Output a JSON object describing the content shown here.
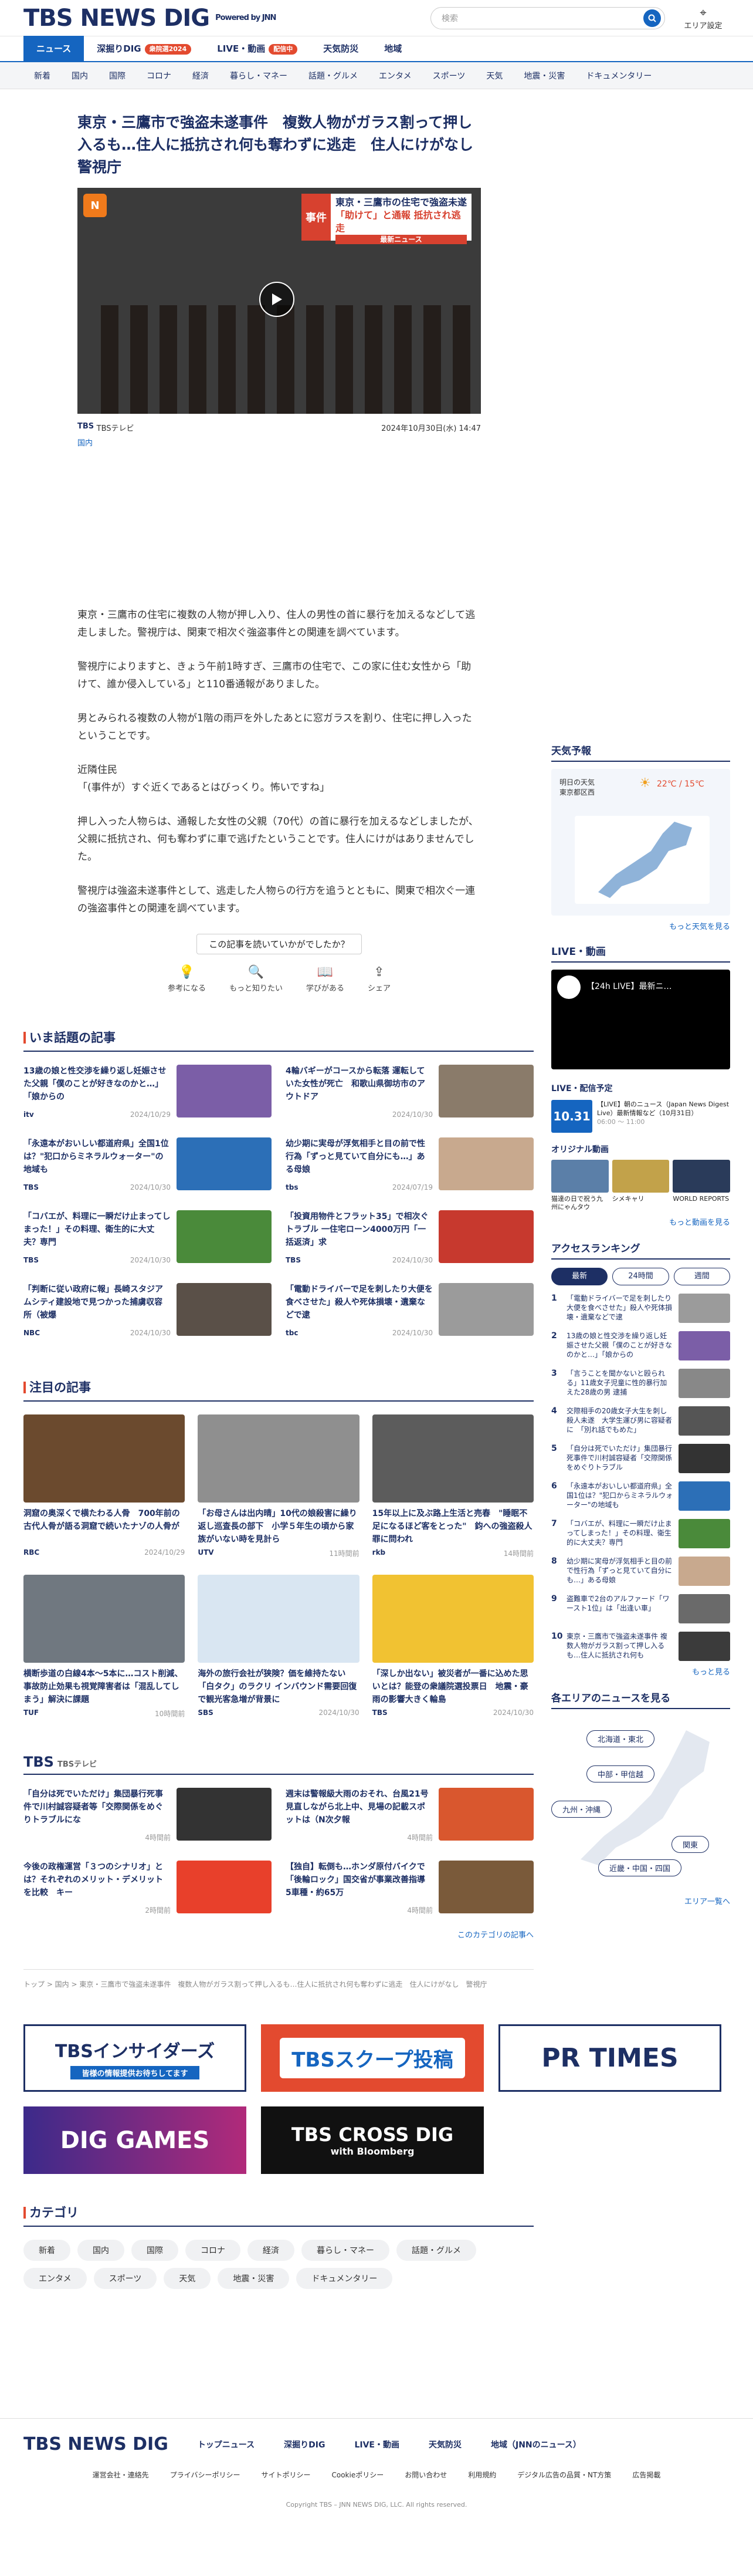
{
  "header": {
    "logo": "TBS NEWS DIG",
    "powered": "Powered by JNN",
    "search_placeholder": "検索",
    "area_label": "エリア設定"
  },
  "nav1": [
    {
      "label": "ニュース"
    },
    {
      "label": "深掘りDIG",
      "tag": "衆院選2024"
    },
    {
      "label": "LIVE・動画",
      "tag": "配信中"
    },
    {
      "label": "天気防災"
    },
    {
      "label": "地域"
    }
  ],
  "nav2": [
    "新着",
    "国内",
    "国際",
    "コロナ",
    "経済",
    "暮らし・マネー",
    "話題・グルメ",
    "エンタメ",
    "スポーツ",
    "天気",
    "地震・災害",
    "ドキュメンタリー"
  ],
  "article": {
    "title": "東京・三鷹市で強盗未遂事件　複数人物がガラス割って押し入るも…住人に抵抗され何も奪わずに逃走　住人にけがなし　警視庁",
    "video_badge": [
      "東京・三鷹市の住宅で強盗未遂",
      "「助けて」と通報 抵抗され逃走",
      "最新ニュース"
    ],
    "video_tag": "事件",
    "source": "TBSテレビ",
    "date": "2024年10月30日(水) 14:47",
    "category": "国内",
    "paragraphs": [
      "東京・三鷹市の住宅に複数の人物が押し入り、住人の男性の首に暴行を加えるなどして逃走しました。警視庁は、関東で相次ぐ強盗事件との関連を調べています。",
      "警視庁によりますと、きょう午前1時すぎ、三鷹市の住宅で、この家に住む女性から「助けて、誰か侵入している」と110番通報がありました。",
      "男とみられる複数の人物が1階の雨戸を外したあとに窓ガラスを割り、住宅に押し入ったということです。",
      "近隣住民\n「(事件が）すぐ近くであるとはびっくり。怖いですね」",
      "押し入った人物らは、通報した女性の父親（70代）の首に暴行を加えるなどしましたが、父親に抵抗され、何も奪わずに車で逃げたということです。住人にけがはありませんでした。",
      "警視庁は強盗未遂事件として、逃走した人物らの行方を追うとともに、関東で相次ぐ一連の強盗事件との関連を調べています。"
    ],
    "feedback_q": "この記事を読いていかがでしたか？",
    "feedback": [
      "参考になる",
      "もっと知りたい",
      "学びがある",
      "シェア"
    ]
  },
  "hot": {
    "title": "いま話題の記事",
    "items": [
      {
        "title": "13歳の娘と性交渉を繰り返し妊娠させた父親「僕のことが好きなのかと…」「娘からの",
        "src": "itv",
        "date": "2024/10/29",
        "color": "#7b5ea7"
      },
      {
        "title": "4輪バギーがコースから転落 運転していた女性が死亡　和歌山県御坊市のアウトドア",
        "src": "",
        "date": "2024/10/30",
        "color": "#8a7b6a"
      },
      {
        "title": "「永遠本がおいしい都道府県」全国1位は？\"犯口からミネラルウォーター\"の地域も",
        "src": "TBS",
        "date": "2024/10/30",
        "color": "#2c6fb7"
      },
      {
        "title": "幼少期に実母が浮気相手と目の前で性行為「ずっと見ていて自分にも…」ある母娘",
        "src": "tbs",
        "date": "2024/07/19",
        "color": "#c8a98e"
      },
      {
        "title": "「コバエが、料理に一瞬だけ止まってしまった！」その料理、衛生的に大丈夫？専門",
        "src": "TBS",
        "date": "2024/10/30",
        "color": "#4a8a3a"
      },
      {
        "title": "「投資用物件とフラット35」で相次ぐトラブル 一住宅ローン4000万円「一括返済」求",
        "src": "TBS",
        "date": "2024/10/30",
        "color": "#c7392e"
      },
      {
        "title": "「判断に従い政府に報」長崎スタジアムシティ建設地で見つかった捕虜収容所（被爆",
        "src": "NBC",
        "date": "2024/10/30",
        "color": "#5a5048"
      },
      {
        "title": "「電動ドライバーで足を刺したり大便を食べさせた」殺人や死体損壊・遺棄などで逮",
        "src": "tbc",
        "date": "2024/10/30",
        "color": "#9b9b9b"
      }
    ]
  },
  "attention": {
    "title": "注目の記事",
    "items": [
      {
        "title": "洞窟の奥深くで横たわる人骨　700年前の古代人骨が語る洞窟で続いたナゾの人骨が",
        "src": "RBC",
        "date": "2024/10/29",
        "color": "#6b4a2e"
      },
      {
        "title": "「お母さんは出内晴」10代の娘殺害に繰り返し巡査長の部下　小学５年生の頃から家族がいない時を見計ら",
        "src": "UTV",
        "date": "11時間前",
        "color": "#8f8f8f"
      },
      {
        "title": "15年以上に及ぶ路上生活と売春　\"睡眠不足になるほど客をとった\"　鈞への強盗殺人罪に問われ",
        "src": "rkb",
        "date": "14時間前",
        "color": "#5c5c5c"
      },
      {
        "title": "横断歩道の白線4本～5本に…コスト削減、事故防止効果も視覚障害者は「混乱してしまう」解決に課題",
        "src": "TUF",
        "date": "10時間前",
        "color": "#707880"
      },
      {
        "title": "海外の旅行会社が狭険？価を維持たない「白タク」のラクリ インバウンド需要回復で観光客急増が背景に",
        "src": "SBS",
        "date": "2024/10/30",
        "color": "#d9e6f2"
      },
      {
        "title": "「深しか出ない」被災者が一番に込めた思いとは？能登の衆議院選投票日　地震・豪雨の影響大きく輪島",
        "src": "TBS",
        "date": "2024/10/30",
        "color": "#f1c232"
      }
    ]
  },
  "tbs": {
    "title": "TBS",
    "sub": "TBSテレビ",
    "items": [
      {
        "title": "「自分は死でいただけ」集団暴行死事件で川村誠容疑者等「交際関係をめぐりトラブルにな",
        "date": "4時間前",
        "color": "#333"
      },
      {
        "title": "週末は警報級大雨のおそれ、台風21号 見直しながら北上中、見場の記載スポットは（N次夕報",
        "date": "4時間前",
        "color": "#d9572e"
      },
      {
        "title": "今後の政権運営「３つのシナリオ」とは？それぞれのメリット・デメリットを比較　キー",
        "date": "2時間前",
        "color": "#e8402b"
      },
      {
        "title": "【独自】転倒も…ホンダ原付バイクで「後輪ロック」国交省が事業改善指導　5車種・約65万",
        "date": "4時間前",
        "color": "#7a5a3a"
      }
    ],
    "more": "このカテゴリの記事へ"
  },
  "crumb": "トップ > 国内 > 東京・三鷹市で強盗未遂事件　複数人物がガラス割って押し入るも…住人に抵抗され何も奪わずに逃走　住人にけがなし　警視庁",
  "banners": [
    "TBSインサイダーズ",
    "TBSスクープ投稿",
    "PR TIMES",
    "DIG GAMES",
    "TBS CROSS DIG",
    "with Bloomberg"
  ],
  "categories": {
    "title": "カテゴリ",
    "items": [
      "新着",
      "国内",
      "国際",
      "コロナ",
      "経済",
      "暮らし・マネー",
      "話題・グルメ",
      "エンタメ",
      "スポーツ",
      "天気",
      "地震・災害",
      "ドキュメンタリー"
    ]
  },
  "side": {
    "weather_title": "天気予報",
    "weather_loc": "明日の天気\n東京都区西",
    "weather_temp": "22℃ / 15℃",
    "weather_more": "もっと天気を見る",
    "live_title": "LIVE・動画",
    "live_label": "【24h LIVE】最新ニ…",
    "schedule_title": "LIVE・配信予定",
    "sched": [
      {
        "date": "2024/10/31",
        "title": "【LIVE】朝のニュース（Japan News Digest Live）最新情報など（10月31日）",
        "time": "06:00 ～ 11:00"
      }
    ],
    "original_title": "オリジナル動画",
    "original": [
      "猫達の日で祝う九州にゃんタウ",
      "シメキャリ",
      "WORLD REPORTS"
    ],
    "original_more": "もっと動画を見る",
    "ranking_title": "アクセスランキング",
    "ranking_tabs": [
      "最新",
      "24時間",
      "週間"
    ],
    "ranking": [
      "「電動ドライバーで足を刺したり大便を食べさせた」殺人や死体損壊・遺棄などで逮",
      "13歳の娘と性交渉を繰り返し妊娠させた父親「僕のことが好きなのかと…」「娘からの",
      "「言うことを聞かないと殴られる」11歳女子児童に性的暴行加えた28歳の男 逮捕",
      "交際相手の20歳女子大生を刺し殺人未遂　大学生運び男に容疑者に　「別れ話でもめた」",
      "「自分は死でいただけ」集団暴行死事件で川村誠容疑者「交際関係をめぐりトラブル",
      "「永遠本がおいしい都道府県」全国1位は？\"犯口からミネラルウォーター\"の地域も",
      "「コバエが、料理に一瞬だけ止まってしまった！」その料理、衛生的に大丈夫？専門",
      "幼少期に実母が浮気相手と目の前で性行為「ずっと見ていて自分にも…」ある母娘",
      "盗難車で2台のアルファード「ワースト1位」は「出逢い車」",
      "東京・三鷹市で強盗未遂事件 複数人物がガラス割って押し入るも…住人に抵抗され何も"
    ],
    "ranking_more": "もっと見る",
    "areas_title": "各エリアのニュースを見る",
    "areas": [
      "北海道・東北",
      "中部・甲信越",
      "九州・沖縄",
      "関東",
      "近畿・中国・四国"
    ],
    "areas_more": "エリア一覧へ"
  },
  "footer": {
    "logo": "TBS NEWS DIG",
    "links": [
      "トップニュース",
      "深掘りDIG",
      "LIVE・動画",
      "天気防災",
      "地域（JNNのニュース）"
    ],
    "links2": [
      "運営会社・連絡先",
      "プライバシーポリシー",
      "サイトポリシー",
      "Cookieポリシー",
      "お問い合わせ",
      "利用規約",
      "デジタル広告の品質・NT方策",
      "広告掲載"
    ],
    "copy": "Copyright TBS – JNN NEWS DIG, LLC. All rights reserved."
  }
}
